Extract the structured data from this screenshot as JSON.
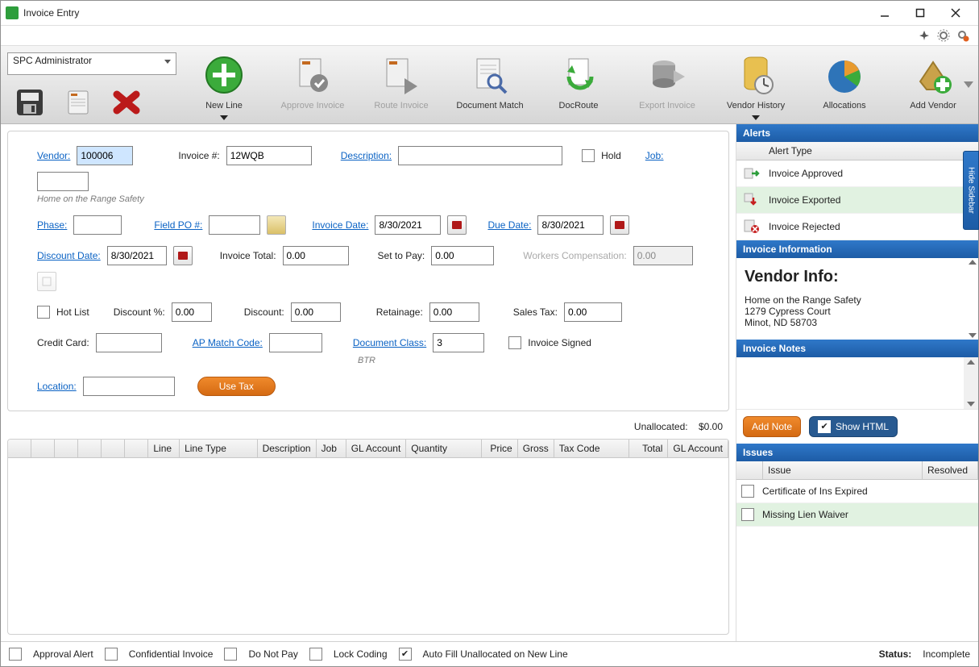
{
  "window": {
    "title": "Invoice Entry"
  },
  "admin_select": "SPC Administrator",
  "toolbar": [
    {
      "key": "new_line",
      "label": "New Line",
      "disabled": false,
      "arrow": true
    },
    {
      "key": "approve",
      "label": "Approve Invoice",
      "disabled": true,
      "arrow": false
    },
    {
      "key": "route",
      "label": "Route Invoice",
      "disabled": true,
      "arrow": false
    },
    {
      "key": "doc_match",
      "label": "Document Match",
      "disabled": false,
      "arrow": false
    },
    {
      "key": "doc_route",
      "label": "DocRoute",
      "disabled": false,
      "arrow": false
    },
    {
      "key": "export",
      "label": "Export Invoice",
      "disabled": true,
      "arrow": false
    },
    {
      "key": "vendor_hist",
      "label": "Vendor History",
      "disabled": false,
      "arrow": true
    },
    {
      "key": "allocations",
      "label": "Allocations",
      "disabled": false,
      "arrow": false
    },
    {
      "key": "add_vendor",
      "label": "Add Vendor",
      "disabled": false,
      "arrow": false
    }
  ],
  "form": {
    "vendor_label": "Vendor:",
    "vendor": "100006",
    "vendor_name": "Home on the Range Safety",
    "invoice_num_label": "Invoice #:",
    "invoice_num": "12WQB",
    "description_label": "Description:",
    "description": "",
    "hold_label": "Hold",
    "hold": false,
    "job_label": "Job:",
    "job": "",
    "phase_label": "Phase:",
    "phase": "",
    "field_po_label": "Field PO #:",
    "field_po": "",
    "invoice_date_label": "Invoice Date:",
    "invoice_date": "8/30/2021",
    "due_date_label": "Due Date:",
    "due_date": "8/30/2021",
    "discount_date_label": "Discount Date:",
    "discount_date": "8/30/2021",
    "invoice_total_label": "Invoice Total:",
    "invoice_total": "0.00",
    "set_to_pay_label": "Set to Pay:",
    "set_to_pay": "0.00",
    "wc_label": "Workers Compensation:",
    "wc": "0.00",
    "hotlist_label": "Hot List",
    "hotlist": false,
    "discount_pct_label": "Discount %:",
    "discount_pct": "0.00",
    "discount_label": "Discount:",
    "discount": "0.00",
    "retainage_label": "Retainage:",
    "retainage": "0.00",
    "sales_tax_label": "Sales Tax:",
    "sales_tax": "0.00",
    "credit_card_label": "Credit Card:",
    "credit_card": "",
    "ap_match_label": "AP Match Code:",
    "ap_match": "",
    "doc_class_label": "Document Class:",
    "doc_class": "3",
    "doc_class_desc": "BTR",
    "invoice_signed_label": "Invoice Signed",
    "invoice_signed": false,
    "location_label": "Location:",
    "location": "",
    "use_tax_label": "Use Tax",
    "unallocated_label": "Unallocated:",
    "unallocated": "$0.00"
  },
  "grid": {
    "columns": [
      "Line",
      "Line Type",
      "Description",
      "Job",
      "GL Account",
      "Quantity",
      "Price",
      "Gross",
      "Tax Code",
      "Total",
      "GL Account"
    ]
  },
  "alerts": {
    "header": "Alerts",
    "col": "Alert Type",
    "rows": [
      {
        "text": "Invoice Approved",
        "hi": false
      },
      {
        "text": "Invoice Exported",
        "hi": true
      },
      {
        "text": "Invoice Rejected",
        "hi": false
      }
    ]
  },
  "info": {
    "header": "Invoice Information",
    "title": "Vendor Info:",
    "lines": [
      "Home on the Range Safety",
      "1279 Cypress Court",
      "Minot, ND 58703"
    ]
  },
  "notes": {
    "header": "Invoice Notes",
    "add": "Add Note",
    "show_html": "Show HTML"
  },
  "issues": {
    "header": "Issues",
    "cols": [
      "",
      "Issue",
      "Resolved"
    ],
    "rows": [
      {
        "text": "Certificate of Ins Expired",
        "hi": false,
        "resolved": false
      },
      {
        "text": "Missing Lien Waiver",
        "hi": true,
        "resolved": false
      }
    ]
  },
  "hide_sidebar": "Hide Sidebar",
  "bottom": {
    "approval": "Approval Alert",
    "confidential": "Confidential Invoice",
    "donotpay": "Do Not Pay",
    "lock": "Lock Coding",
    "autofill": "Auto Fill Unallocated on New Line",
    "autofill_on": true,
    "status_label": "Status:",
    "status": "Incomplete"
  }
}
